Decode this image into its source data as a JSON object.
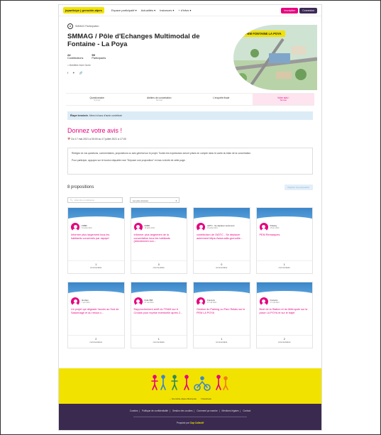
{
  "header": {
    "logo": "jeparticipe | grenoble-alpes",
    "nav": [
      "Espace participatif ▾",
      "Actualités ▾",
      "Instances ▾",
      "+ d'infos ▾"
    ],
    "signup": "Inscription",
    "login": "Connexion"
  },
  "hero": {
    "org_initials": "M",
    "org_name": "SMMAG Participation",
    "title": "SMMAG / Pôle d'Echanges Multimodal de Fontaine - La Poya",
    "contributions_num": "24",
    "contributions_label": "Contributions",
    "participants_num": "59",
    "participants_label": "Participants",
    "tag": "□ Mobilités Nord Ouest",
    "share": [
      "f",
      "✦",
      "🔗"
    ],
    "badge": "PEM FONTAINE LA POYA"
  },
  "steps": [
    {
      "label": "Questionnaire",
      "sub": "Terminé"
    },
    {
      "label": "Ateliers de concertation",
      "sub": "Terminé"
    },
    {
      "label": "L'enquête finale",
      "sub": ""
    },
    {
      "label": "Votre avis !",
      "sub": "Terminé"
    }
  ],
  "notice": {
    "strong": "Étape terminée.",
    "text": " Merci à tous d'avoir contribué."
  },
  "give": {
    "heading": "Donnez votre avis !",
    "dates": "📅 Du 17 mai 2021 à 00:00 au 17 juillet 2021 à 17:00",
    "p1": "Rédigez ici vos questions, commentaires, propositions ou avis général sur le projet. Toutes les expressions seront prises en compte dans le cadre du bilan de la concertation.",
    "p2": "Pour participer, appuyez sur le bouton cliquable rose \"Déposer une proposition\" en bas à droite de cette page."
  },
  "proposals": {
    "count": "8 propositions",
    "submit": "Déposer une proposition",
    "search_placeholder": "Votre titre ou référence",
    "sort": "Les plus récentes"
  },
  "cards": [
    {
      "author": "FDBD",
      "date": "16 juillet 2021",
      "title": "Informer plus largement tous les habitants concernés par rapoprt",
      "count": "1",
      "label": "commentaire"
    },
    {
      "author": "FDBD",
      "date": "16 juillet 2021",
      "title": "Informer plus largement de la concertation tous les habitants (directement con...",
      "count": "0",
      "label": "commentaire"
    },
    {
      "author": "ADTC - Se déplacer autrement",
      "date": "16 juillet 2021",
      "title": "contribution de l'ADTC - Se déplacer autrement https://www.adtc-grenoble...",
      "count": "0",
      "label": "commentaire"
    },
    {
      "author": "Pidesky",
      "date": "15 juin 2021",
      "title": "PEM Remarques",
      "count": "1",
      "label": "commentaire"
    },
    {
      "author": "Ikonlam",
      "date": "7 juin 2021",
      "title": "Un projet qui dégrade l'accès au Sud de Sassenage et au ressor c...",
      "count": "2",
      "label": "commentaires"
    },
    {
      "author": "Pelle 888",
      "date": "27 mai 2021",
      "title": "Rapprochement arrêt du TRAM sur A Croizat pour reprise éventuelle après 2...",
      "count": "1",
      "label": "commentaire"
    },
    {
      "author": "François",
      "date": "27 mai 2021",
      "title": "Gestion du Parking ou Parc Relais sur le PEM LA POYA",
      "count": "1",
      "label": "commentaire"
    },
    {
      "author": "François",
      "date": "27 mai 2021",
      "title": "Bruit de la Station et du Métropole sur la place LA POYA et sur le trajet",
      "count": "2",
      "label": "commentaires"
    }
  ],
  "footer": {
    "social": [
      "→ Grenoble-Alpes Métropole",
      "f Facebook"
    ],
    "links": [
      "Cookies",
      "Politique de confidentialité",
      "Gestion des cookies",
      "Comment ça marche",
      "Mentions légales",
      "Contact"
    ],
    "powered_prefix": "Propulsé par",
    "powered_brand": "Cap Collectif"
  },
  "colors": {
    "accent": "#e6007e",
    "yellow": "#f2e200",
    "dark": "#3a2a4f",
    "blue": "#3a86c8"
  }
}
